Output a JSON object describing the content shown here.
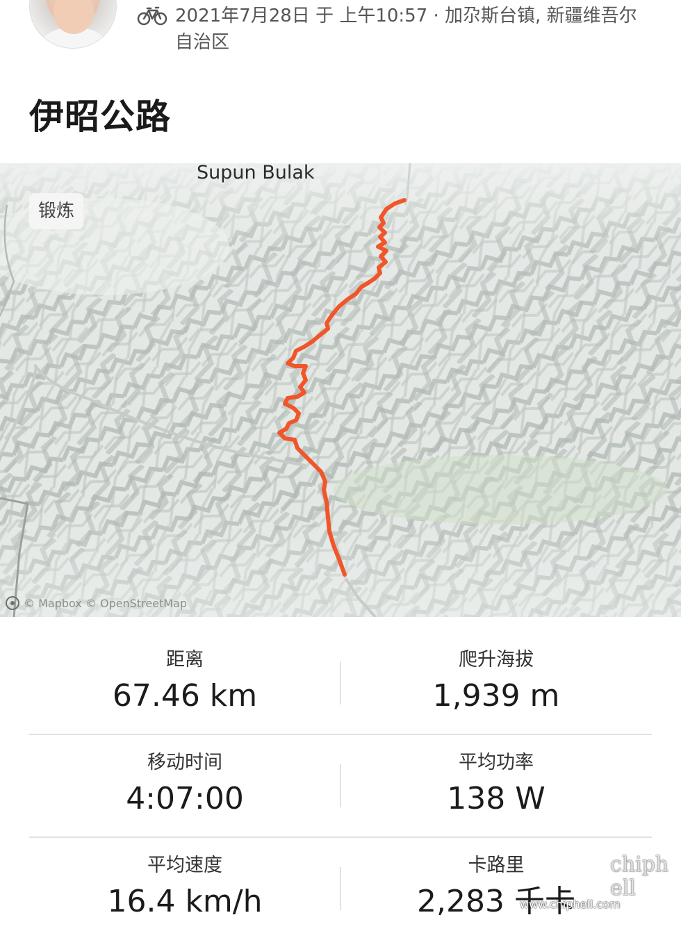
{
  "activity": {
    "meta_line": "2021年7月28日 于 上午10:57 · 加尕斯台镇, 新疆维吾尔自治区",
    "title": "伊昭公路",
    "type_icon": "bicycle-icon"
  },
  "map": {
    "place_label": "Supun Bulak",
    "badge": "锻炼",
    "attribution": "© Mapbox © OpenStreetMap",
    "route_color": "#f0562a"
  },
  "stats": [
    {
      "label": "距离",
      "value": "67.46 km"
    },
    {
      "label": "爬升海拔",
      "value": "1,939 m"
    },
    {
      "label": "移动时间",
      "value": "4:07:00"
    },
    {
      "label": "平均功率",
      "value": "138 W"
    },
    {
      "label": "平均速度",
      "value": "16.4 km/h"
    },
    {
      "label": "卡路里",
      "value": "2,283 千卡"
    }
  ],
  "watermark": {
    "logo": "chiphell",
    "url": "www.chiphell.com"
  }
}
